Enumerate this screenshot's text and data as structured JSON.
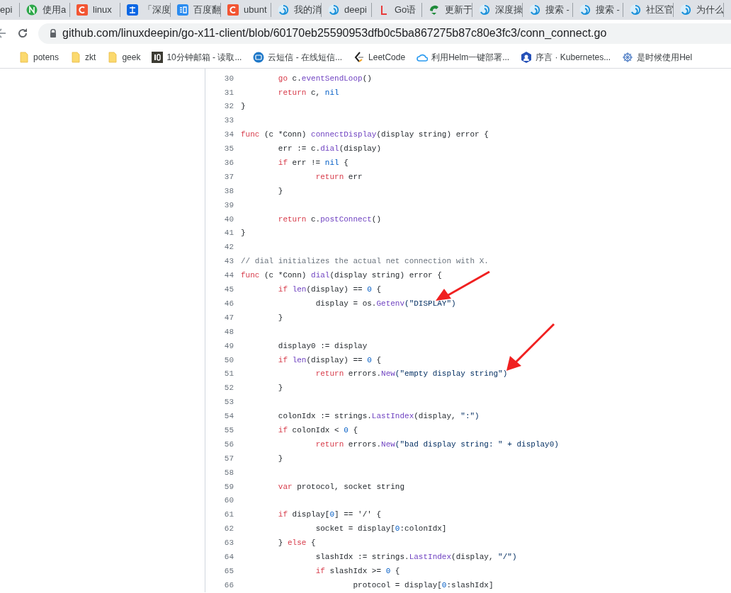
{
  "tabs": [
    {
      "title": "epi"
    },
    {
      "title": "使用a",
      "kind": "n-circle"
    },
    {
      "title": "linux",
      "kind": "c-square"
    },
    {
      "title": "「深度",
      "kind": "zhi-square"
    },
    {
      "title": "百度翻",
      "kind": "yi-square"
    },
    {
      "title": "ubunt",
      "kind": "c-square"
    },
    {
      "title": "我的消",
      "kind": "swirl"
    },
    {
      "title": "deepi",
      "kind": "swirl"
    },
    {
      "title": "Go语",
      "kind": "l-letter"
    },
    {
      "title": "更新于",
      "kind": "green-leaf"
    },
    {
      "title": "深度操",
      "kind": "swirl"
    },
    {
      "title": "搜索 -",
      "kind": "swirl"
    },
    {
      "title": "搜索 -",
      "kind": "swirl"
    },
    {
      "title": "社区官",
      "kind": "swirl"
    },
    {
      "title": "为什么",
      "kind": "swirl"
    }
  ],
  "address_bar": {
    "url": "github.com/linuxdeepin/go-x11-client/blob/60170eb25590953dfb0c5ba867275b87c80e3fc3/conn_connect.go"
  },
  "bookmarks": [
    {
      "label": "potens",
      "kind": "folder"
    },
    {
      "label": "zkt",
      "kind": "folder"
    },
    {
      "label": "geek",
      "kind": "folder"
    },
    {
      "label": "10分钟邮箱 - 读取...",
      "kind": "dark-square"
    },
    {
      "label": "云短信 - 在线短信...",
      "kind": "blue-chat"
    },
    {
      "label": "LeetCode",
      "kind": "leetcode"
    },
    {
      "label": "利用Helm一键部署...",
      "kind": "cloud"
    },
    {
      "label": "序言 · Kubernetes...",
      "kind": "blue-badge"
    },
    {
      "label": "是时候使用Hel",
      "kind": "wheel"
    }
  ],
  "code_lines": [
    {
      "number": "30",
      "tokens": [
        {
          "kind": "keyword",
          "text": "\tgo"
        },
        {
          "kind": "plain",
          "text": " c."
        },
        {
          "kind": "function",
          "text": "eventSendLoop"
        },
        {
          "kind": "plain",
          "text": "()"
        }
      ]
    },
    {
      "number": "31",
      "tokens": [
        {
          "kind": "keyword",
          "text": "\treturn"
        },
        {
          "kind": "plain",
          "text": " c, "
        },
        {
          "kind": "constant",
          "text": "nil"
        }
      ]
    },
    {
      "number": "32",
      "tokens": [
        {
          "kind": "plain",
          "text": "}"
        }
      ]
    },
    {
      "number": "33"
    },
    {
      "number": "34",
      "tokens": [
        {
          "kind": "keyword",
          "text": "func"
        },
        {
          "kind": "plain",
          "text": " (c *Conn) "
        },
        {
          "kind": "function",
          "text": "connectDisplay"
        },
        {
          "kind": "plain",
          "text": "(display string) error {"
        }
      ]
    },
    {
      "number": "35",
      "tokens": [
        {
          "kind": "plain",
          "text": "\terr := c."
        },
        {
          "kind": "function",
          "text": "dial"
        },
        {
          "kind": "plain",
          "text": "(display)"
        }
      ]
    },
    {
      "number": "36",
      "tokens": [
        {
          "kind": "keyword",
          "text": "\tif"
        },
        {
          "kind": "plain",
          "text": " err != "
        },
        {
          "kind": "constant",
          "text": "nil"
        },
        {
          "kind": "plain",
          "text": " {"
        }
      ]
    },
    {
      "number": "37",
      "tokens": [
        {
          "kind": "keyword",
          "text": "\t\treturn"
        },
        {
          "kind": "plain",
          "text": " err"
        }
      ]
    },
    {
      "number": "38",
      "tokens": [
        {
          "kind": "plain",
          "text": "\t}"
        }
      ]
    },
    {
      "number": "39"
    },
    {
      "number": "40",
      "tokens": [
        {
          "kind": "keyword",
          "text": "\treturn"
        },
        {
          "kind": "plain",
          "text": " c."
        },
        {
          "kind": "function",
          "text": "postConnect"
        },
        {
          "kind": "plain",
          "text": "()"
        }
      ]
    },
    {
      "number": "41",
      "tokens": [
        {
          "kind": "plain",
          "text": "}"
        }
      ]
    },
    {
      "number": "42"
    },
    {
      "number": "43",
      "tokens": [
        {
          "kind": "comment",
          "text": "// dial initializes the actual net connection with X."
        }
      ]
    },
    {
      "number": "44",
      "tokens": [
        {
          "kind": "keyword",
          "text": "func"
        },
        {
          "kind": "plain",
          "text": " (c *Conn) "
        },
        {
          "kind": "function",
          "text": "dial"
        },
        {
          "kind": "plain",
          "text": "(display string) error {"
        }
      ]
    },
    {
      "number": "45",
      "tokens": [
        {
          "kind": "keyword",
          "text": "\tif "
        },
        {
          "kind": "function",
          "text": "len"
        },
        {
          "kind": "plain",
          "text": "(display) == "
        },
        {
          "kind": "constant",
          "text": "0"
        },
        {
          "kind": "plain",
          "text": " {"
        }
      ]
    },
    {
      "number": "46",
      "tokens": [
        {
          "kind": "plain",
          "text": "\t\tdisplay = os."
        },
        {
          "kind": "function",
          "text": "Getenv"
        },
        {
          "kind": "string",
          "text": "(\"DISPLAY\")"
        }
      ]
    },
    {
      "number": "47",
      "tokens": [
        {
          "kind": "plain",
          "text": "\t}"
        }
      ]
    },
    {
      "number": "48"
    },
    {
      "number": "49",
      "tokens": [
        {
          "kind": "plain",
          "text": "\tdisplay0 := display"
        }
      ]
    },
    {
      "number": "50",
      "tokens": [
        {
          "kind": "keyword",
          "text": "\tif "
        },
        {
          "kind": "function",
          "text": "len"
        },
        {
          "kind": "plain",
          "text": "(display) == "
        },
        {
          "kind": "constant",
          "text": "0"
        },
        {
          "kind": "plain",
          "text": " {"
        }
      ]
    },
    {
      "number": "51",
      "tokens": [
        {
          "kind": "keyword",
          "text": "\t\treturn"
        },
        {
          "kind": "plain",
          "text": " errors."
        },
        {
          "kind": "function",
          "text": "New"
        },
        {
          "kind": "string",
          "text": "(\"empty display string\")"
        }
      ]
    },
    {
      "number": "52",
      "tokens": [
        {
          "kind": "plain",
          "text": "\t}"
        }
      ]
    },
    {
      "number": "53"
    },
    {
      "number": "54",
      "tokens": [
        {
          "kind": "plain",
          "text": "\tcolonIdx := strings."
        },
        {
          "kind": "function",
          "text": "LastIndex"
        },
        {
          "kind": "plain",
          "text": "(display, "
        },
        {
          "kind": "string",
          "text": "\":\")"
        }
      ]
    },
    {
      "number": "55",
      "tokens": [
        {
          "kind": "keyword",
          "text": "\tif"
        },
        {
          "kind": "plain",
          "text": " colonIdx < "
        },
        {
          "kind": "constant",
          "text": "0"
        },
        {
          "kind": "plain",
          "text": " {"
        }
      ]
    },
    {
      "number": "56",
      "tokens": [
        {
          "kind": "keyword",
          "text": "\t\treturn"
        },
        {
          "kind": "plain",
          "text": " errors."
        },
        {
          "kind": "function",
          "text": "New"
        },
        {
          "kind": "string",
          "text": "(\"bad display string: \" + display0)"
        }
      ]
    },
    {
      "number": "57",
      "tokens": [
        {
          "kind": "plain",
          "text": "\t}"
        }
      ]
    },
    {
      "number": "58"
    },
    {
      "number": "59",
      "tokens": [
        {
          "kind": "keyword",
          "text": "\tvar"
        },
        {
          "kind": "plain",
          "text": " protocol, socket string"
        }
      ]
    },
    {
      "number": "60"
    },
    {
      "number": "61",
      "tokens": [
        {
          "kind": "keyword",
          "text": "\tif"
        },
        {
          "kind": "plain",
          "text": " display["
        },
        {
          "kind": "constant",
          "text": "0"
        },
        {
          "kind": "plain",
          "text": "] == '/' {"
        }
      ]
    },
    {
      "number": "62",
      "tokens": [
        {
          "kind": "plain",
          "text": "\t\tsocket = display["
        },
        {
          "kind": "constant",
          "text": "0"
        },
        {
          "kind": "plain",
          "text": ":colonIdx]"
        }
      ]
    },
    {
      "number": "63",
      "tokens": [
        {
          "kind": "plain",
          "text": "\t} "
        },
        {
          "kind": "keyword",
          "text": "else"
        },
        {
          "kind": "plain",
          "text": " {"
        }
      ]
    },
    {
      "number": "64",
      "tokens": [
        {
          "kind": "plain",
          "text": "\t\tslashIdx := strings."
        },
        {
          "kind": "function",
          "text": "LastIndex"
        },
        {
          "kind": "plain",
          "text": "(display, "
        },
        {
          "kind": "string",
          "text": "\"/\")"
        }
      ]
    },
    {
      "number": "65",
      "tokens": [
        {
          "kind": "keyword",
          "text": "\t\tif"
        },
        {
          "kind": "plain",
          "text": " slashIdx >= "
        },
        {
          "kind": "constant",
          "text": "0"
        },
        {
          "kind": "plain",
          "text": " {"
        }
      ]
    },
    {
      "number": "66",
      "tokens": [
        {
          "kind": "plain",
          "text": "\t\t\tprotocol = display["
        },
        {
          "kind": "constant",
          "text": "0"
        },
        {
          "kind": "plain",
          "text": ":slashIdx]"
        }
      ]
    }
  ]
}
